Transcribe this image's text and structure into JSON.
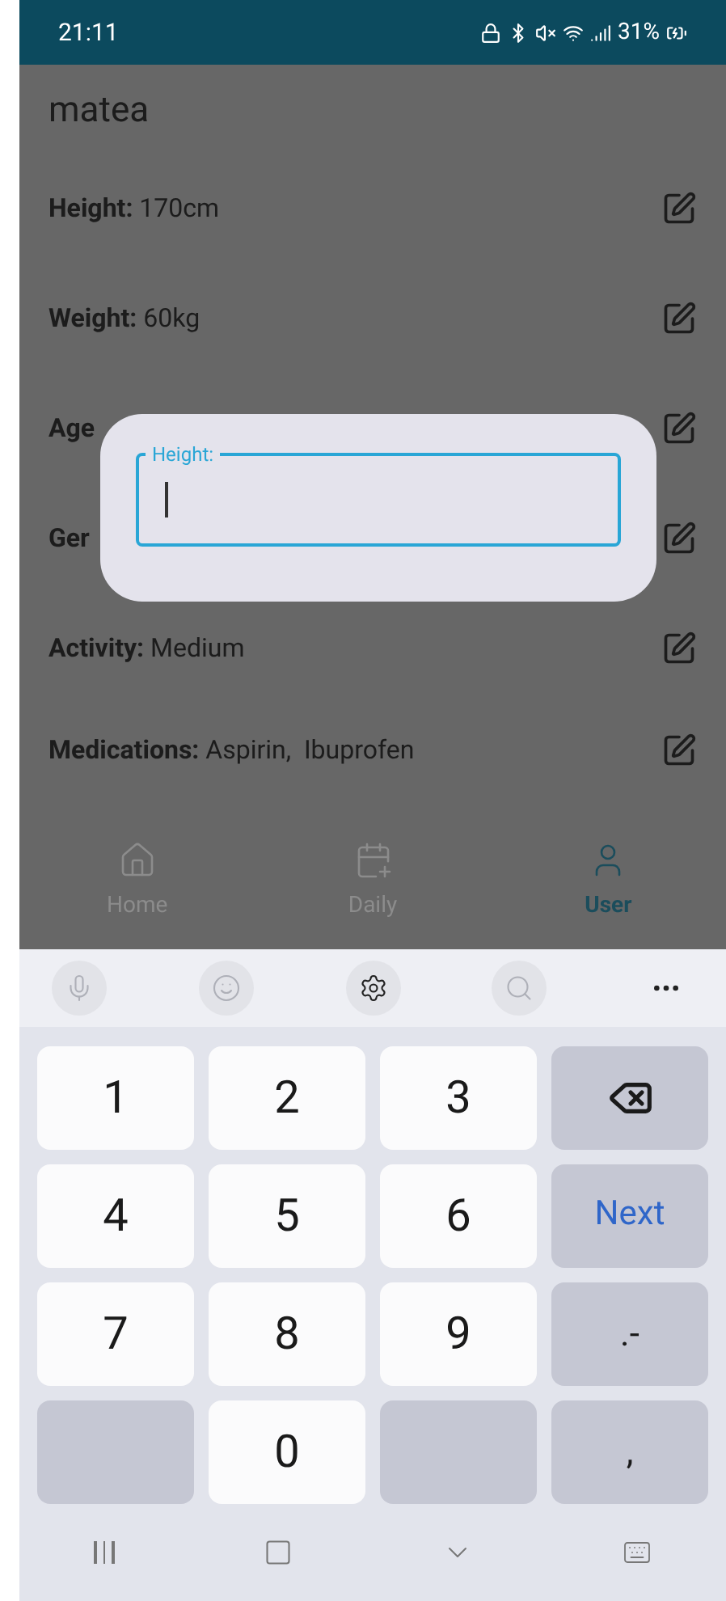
{
  "status_bar": {
    "time": "21:11",
    "battery": "31%"
  },
  "profile": {
    "name": "matea",
    "rows": [
      {
        "label": "Height:",
        "value": "170cm"
      },
      {
        "label": "Weight:",
        "value": "60kg"
      },
      {
        "label": "Age"
      },
      {
        "label": "Ger"
      },
      {
        "label": "Activity:",
        "value": "Medium"
      },
      {
        "label": "Medications:",
        "value": "Aspirin,  Ibuprofen"
      }
    ]
  },
  "bottom_nav": [
    {
      "label": "Home",
      "kind": "home",
      "selected": false
    },
    {
      "label": "Daily",
      "kind": "calendar",
      "selected": false
    },
    {
      "label": "User",
      "kind": "user",
      "selected": true
    }
  ],
  "dialog": {
    "field_label": "Height:",
    "focused": true
  },
  "keyboard": {
    "toolbar": [
      {
        "kind": "mic",
        "disabled": true
      },
      {
        "kind": "emoji",
        "disabled": true
      },
      {
        "kind": "settings",
        "disabled": false
      },
      {
        "kind": "search",
        "disabled": true
      },
      {
        "kind": "more"
      }
    ],
    "keys": [
      {
        "kind": "digit",
        "label": "1"
      },
      {
        "kind": "digit",
        "label": "2"
      },
      {
        "kind": "digit",
        "label": "3"
      },
      {
        "kind": "backspace"
      },
      {
        "kind": "digit",
        "label": "4"
      },
      {
        "kind": "digit",
        "label": "5"
      },
      {
        "kind": "digit",
        "label": "6"
      },
      {
        "kind": "action",
        "label": "Next"
      },
      {
        "kind": "digit",
        "label": "7"
      },
      {
        "kind": "digit",
        "label": "8"
      },
      {
        "kind": "digit",
        "label": "9"
      },
      {
        "kind": "symbol",
        "label": ".-"
      },
      {
        "kind": "blank"
      },
      {
        "kind": "digit",
        "label": "0"
      },
      {
        "kind": "blank"
      },
      {
        "kind": "symbol",
        "label": ","
      }
    ]
  }
}
